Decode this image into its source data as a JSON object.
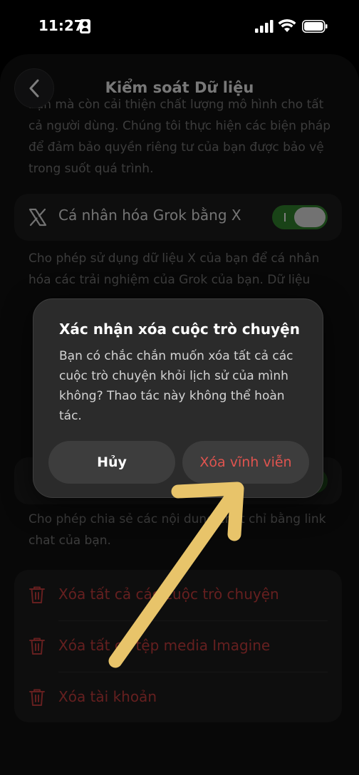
{
  "status_bar": {
    "time": "11:27"
  },
  "header": {
    "title": "Kiểm soát Dữ liệu"
  },
  "intro_text": "bạn mà còn cải thiện chất lượng mô hình cho tất cả người dùng. Chúng tôi thực hiện các biện pháp để đảm bảo quyền riêng tư của bạn được bảo vệ trong suốt quá trình.",
  "personalize": {
    "label": "Cá nhân hóa Grok bằng X",
    "enabled": true,
    "description": "Cho phép sử dụng dữ liệu X của bạn để cá nhân hóa các trải nghiệm của Grok của bạn. Dữ liệu"
  },
  "share": {
    "description": "Cho phép chia sẻ các nội dung chat chỉ bằng link chat của bạn."
  },
  "danger_actions": [
    {
      "label": "Xóa tất cả các cuộc trò chuyện"
    },
    {
      "label": "Xóa tất cả tệp media Imagine"
    },
    {
      "label": "Xóa tài khoản"
    }
  ],
  "dialog": {
    "title": "Xác nhận xóa cuộc trò chuyện",
    "message": "Bạn có chắc chắn muốn xóa tất cả các cuộc trò chuyện khỏi lịch sử của mình không? Thao tác này không thể hoàn tác.",
    "cancel_label": "Hủy",
    "confirm_label": "Xóa vĩnh viễn"
  },
  "colors": {
    "danger": "#e0544f",
    "toggle_on": "#2f7a2b",
    "annotation_arrow": "#e8c46a"
  }
}
